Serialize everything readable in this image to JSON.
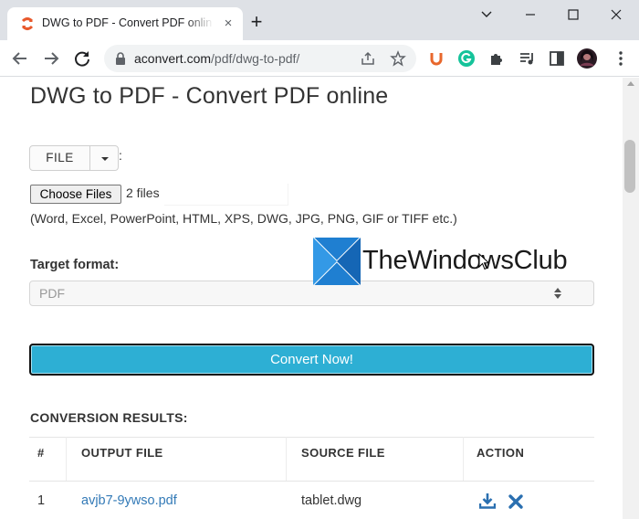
{
  "browser": {
    "tab": {
      "title": "DWG to PDF - Convert PDF online - aconvert.com",
      "close_icon": "×",
      "favicon": "aconvert-logo-icon"
    },
    "new_tab_label": "+",
    "window_controls": {
      "minimize": "⌄",
      "restore": "—",
      "maximize": "☐",
      "close": "✕"
    },
    "address_bar": {
      "host": "aconvert.com",
      "path": "/pdf/dwg-to-pdf/"
    },
    "extensions": [
      "ublock-icon",
      "grammarly-icon",
      "extensions-puzzle-icon",
      "media-control-icon",
      "side-panel-icon",
      "profile-avatar",
      "more-menu-icon"
    ]
  },
  "page": {
    "title": "DWG to PDF - Convert PDF online",
    "source_button": "FILE",
    "source_colon": ":",
    "choose_files_label": "Choose Files",
    "choose_files_status": "2 files",
    "supported_formats": "(Word, Excel, PowerPoint, HTML, XPS, DWG, JPG, PNG, GIF or TIFF etc.)",
    "target_format_label": "Target format:",
    "target_format_value": "PDF",
    "convert_button": "Convert Now!",
    "results_label": "CONVERSION RESULTS:",
    "results_table": {
      "headers": [
        "#",
        "OUTPUT FILE",
        "SOURCE FILE",
        "ACTION"
      ],
      "rows": [
        {
          "index": "1",
          "output_file": "avjb7-9ywso.pdf",
          "source_file": "tablet.dwg",
          "actions": [
            "download-icon",
            "delete-icon"
          ]
        }
      ]
    }
  },
  "watermark": {
    "text": "TheWindowsClub"
  },
  "colors": {
    "accent_button": "#2dafd4",
    "link": "#337ab7",
    "action_icons": "#2a6fb0"
  }
}
